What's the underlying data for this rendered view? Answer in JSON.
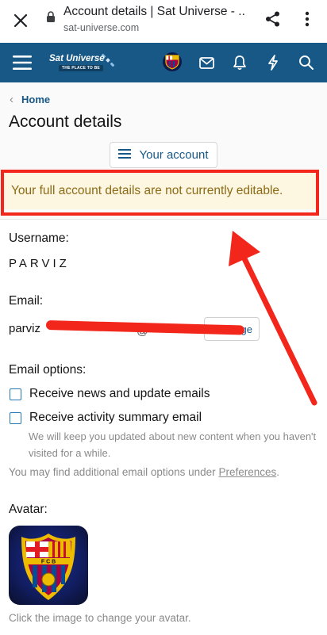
{
  "browser": {
    "title": "Account details | Sat Universe - ...",
    "host": "sat-universe.com"
  },
  "site": {
    "logo_text": "Sat Universe",
    "logo_tagline": "THE PLACE TO BE"
  },
  "breadcrumb": {
    "home": "Home"
  },
  "page": {
    "title": "Account details",
    "menu_button": "Your account",
    "notice": "Your full account details are not currently editable."
  },
  "form": {
    "username_label": "Username:",
    "username_value": "PARVIZ",
    "email_label": "Email:",
    "email_value": "parviz",
    "email_suffix": "@",
    "change_button": "ge",
    "email_options_label": "Email options:",
    "option_news": "Receive news and update emails",
    "option_activity": "Receive activity summary email",
    "activity_hint": "We will keep you updated about new content when you haven't visited for a while.",
    "pref_text": "You may find additional email options under ",
    "pref_link": "Preferences",
    "pref_end": ".",
    "avatar_label": "Avatar:",
    "avatar_hint": "Click the image to change your avatar."
  },
  "colors": {
    "nav": "#185886",
    "annotation": "#f2261b",
    "notice_bg": "#fdf7e1",
    "notice_text": "#8c6a16"
  }
}
